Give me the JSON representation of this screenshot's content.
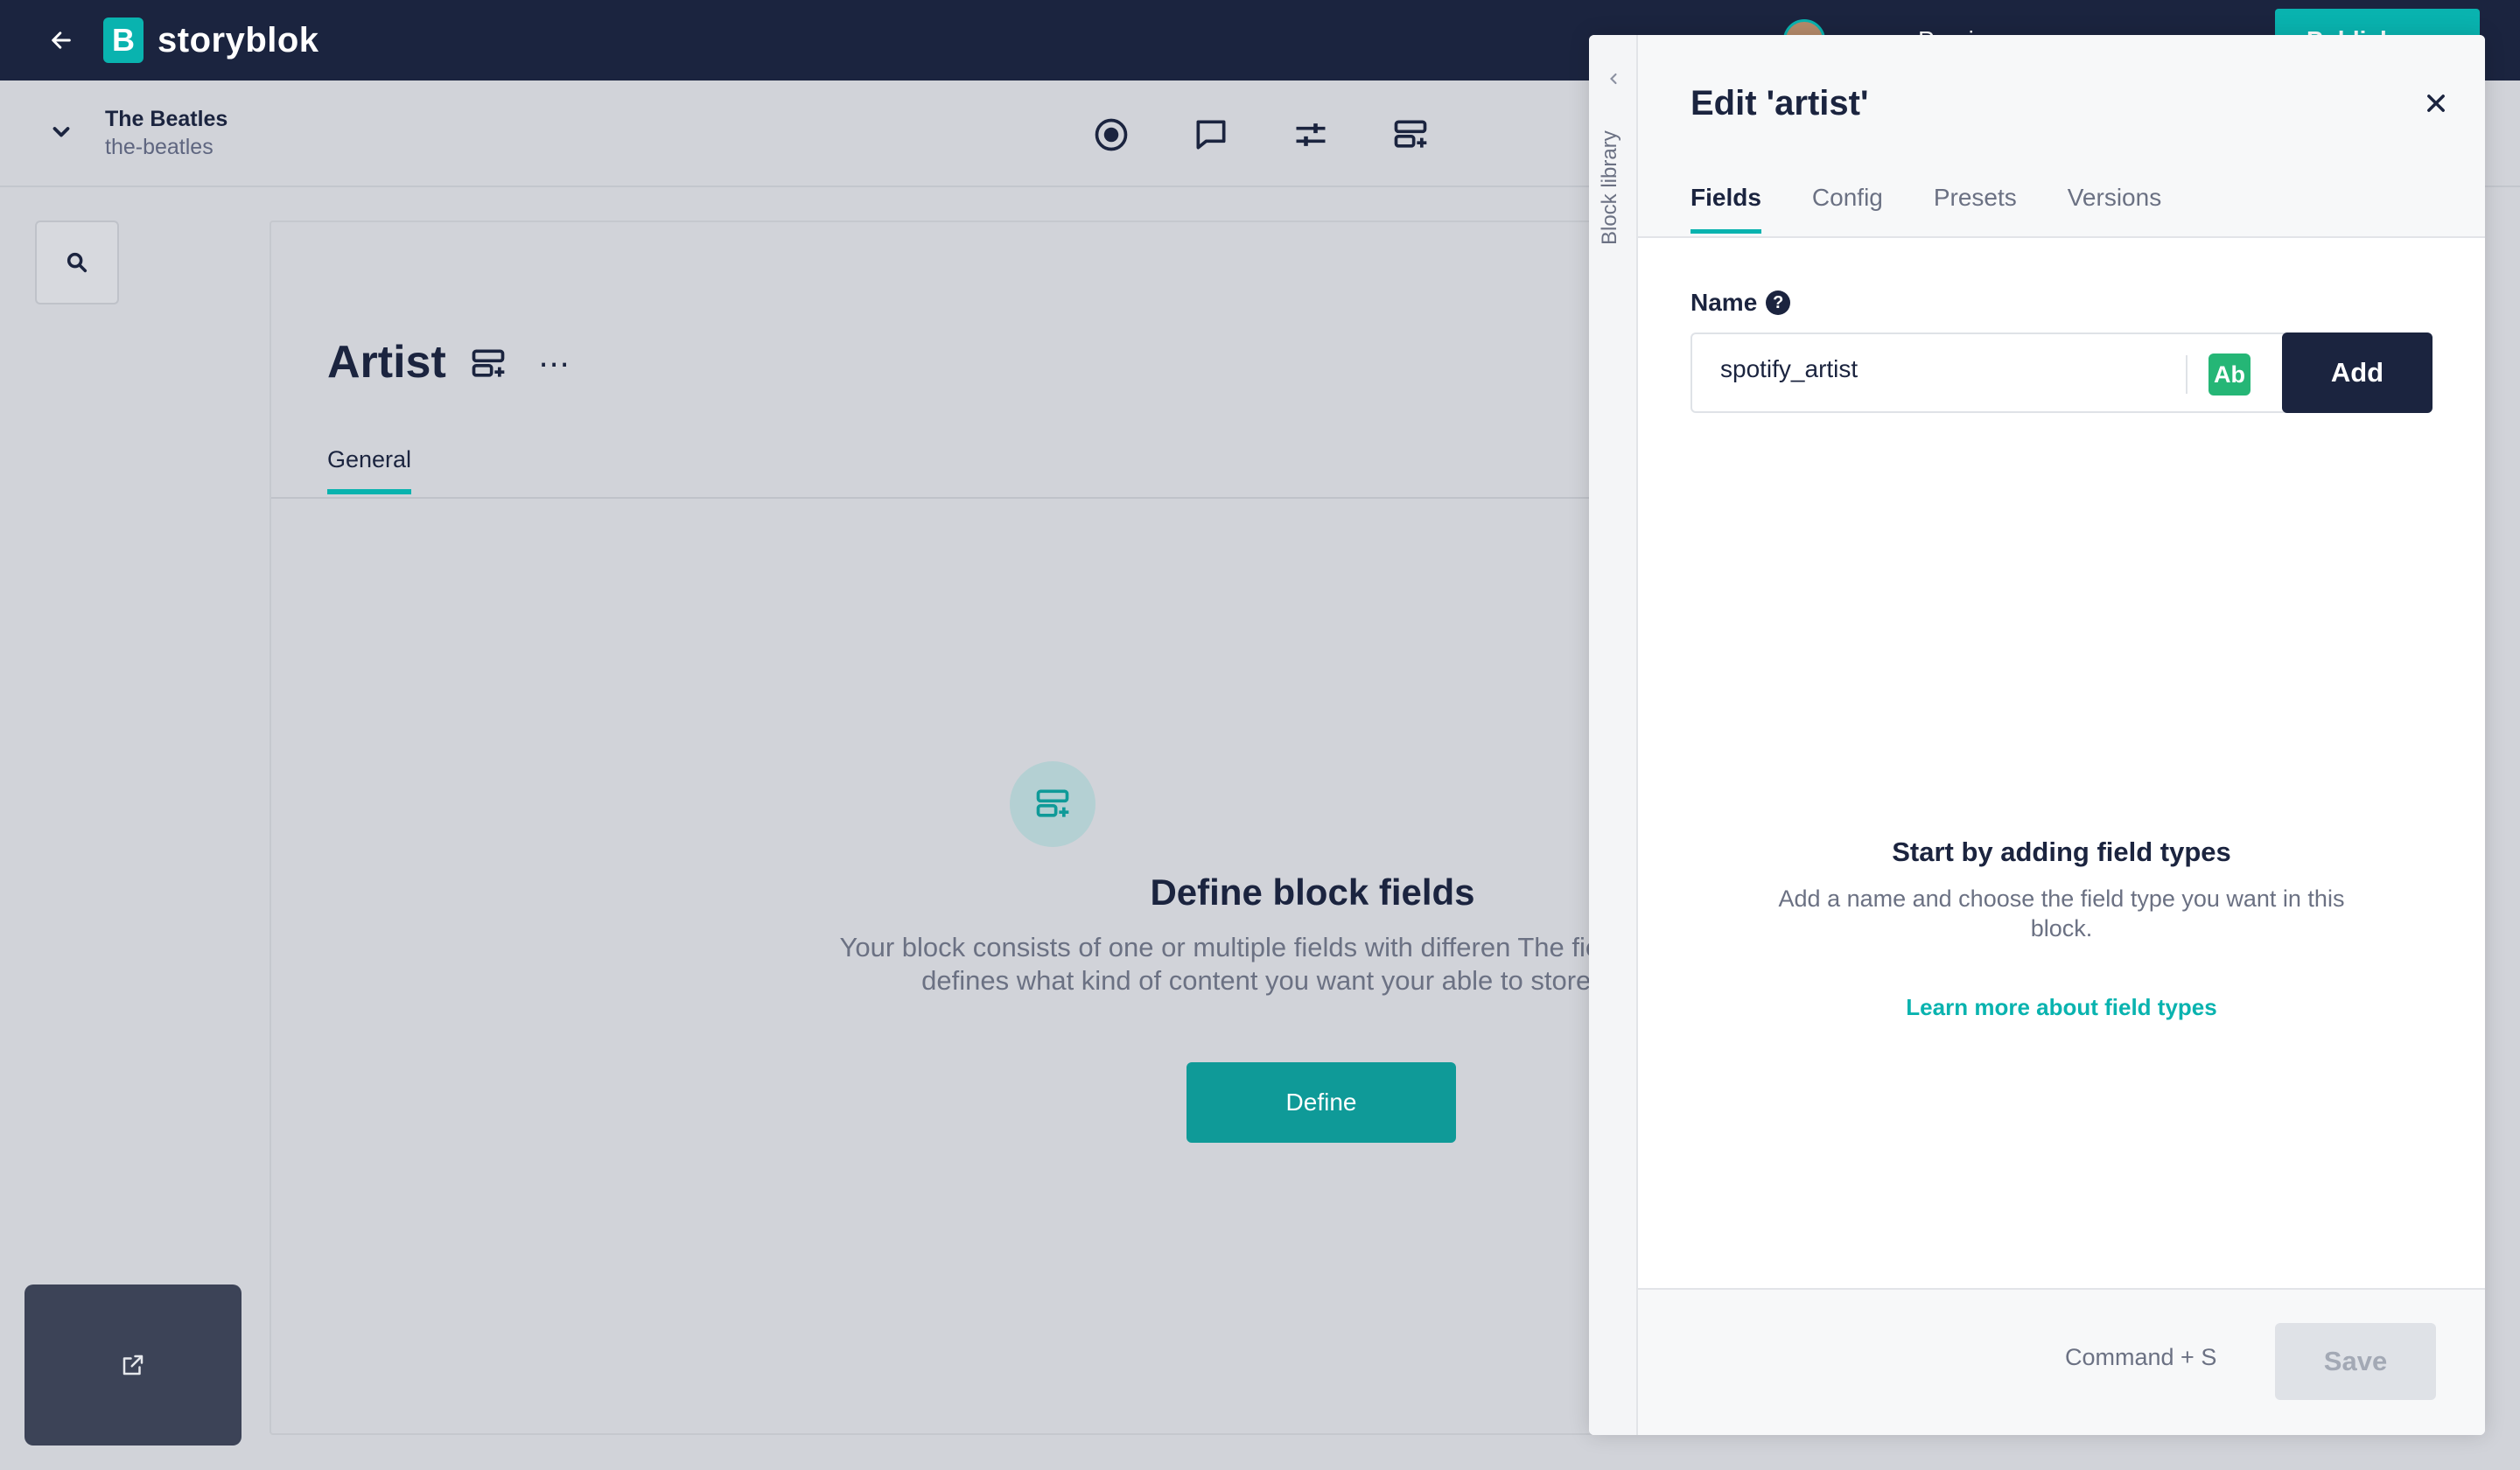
{
  "topbar": {
    "logo_text": "storyblok",
    "logo_letter": "B",
    "user_label": "Previ",
    "publish_label": "Publish",
    "brand_color": "#09b3af",
    "bar_color": "#1b243f"
  },
  "space": {
    "name": "The Beatles",
    "slug": "the-beatles"
  },
  "main": {
    "title": "Artist",
    "more_label": "⋯",
    "tabs": [
      {
        "label": "General"
      }
    ],
    "empty_state": {
      "title": "Define block fields",
      "description": "Your block consists of one or multiple fields with differen The field type defines what kind of content you want your able to store.",
      "button_label": "Define"
    }
  },
  "drawer": {
    "rail_label": "Block library",
    "title": "Edit 'artist'",
    "tabs": [
      {
        "label": "Fields",
        "active": true
      },
      {
        "label": "Config",
        "active": false
      },
      {
        "label": "Presets",
        "active": false
      },
      {
        "label": "Versions",
        "active": false
      }
    ],
    "name_label": "Name",
    "help_glyph": "?",
    "name_value": "spotify_artist",
    "field_type_badge": "Ab",
    "add_label": "Add",
    "empty_title": "Start by adding field types",
    "empty_desc": "Add a name and choose the field type you want in this block.",
    "learn_more": "Learn more about field types",
    "shortcut": "Command + S",
    "save_label": "Save"
  },
  "icons": {
    "back": "arrow-left-icon",
    "space_toggle": "chevron-down-icon",
    "center": [
      "record-icon",
      "comment-icon",
      "sliders-icon",
      "block-add-icon"
    ],
    "search": "search-icon",
    "close": "close-icon",
    "rail": "chevron-left-icon",
    "preview": "external-link-icon"
  }
}
